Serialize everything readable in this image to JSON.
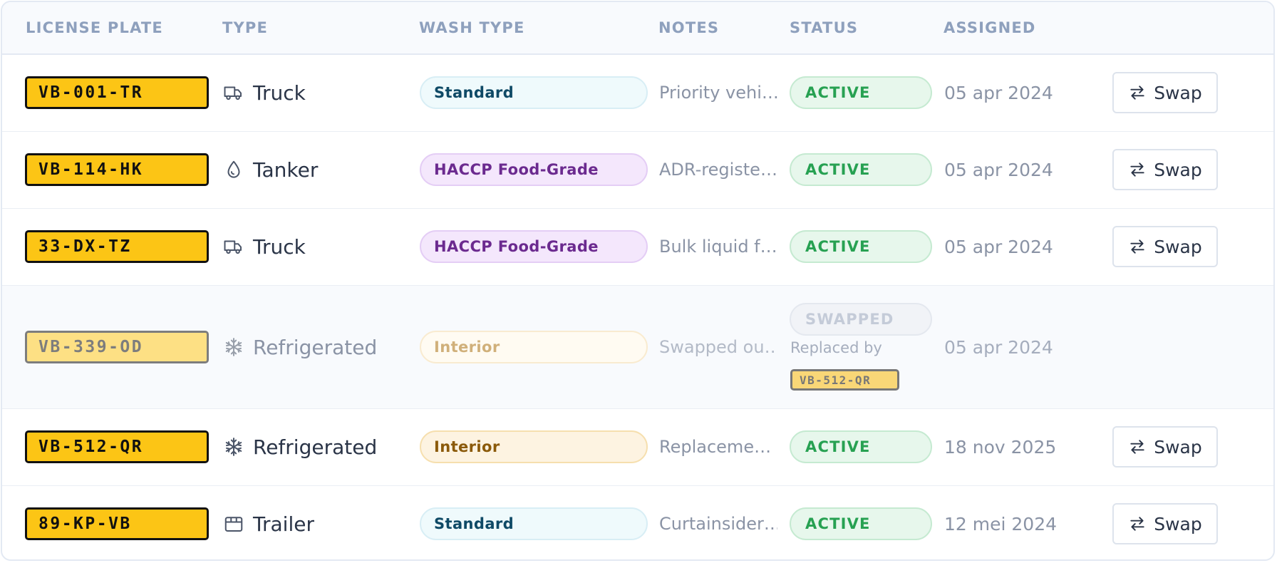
{
  "headers": {
    "license_plate": "LICENSE PLATE",
    "type": "TYPE",
    "wash_type": "WASH TYPE",
    "notes": "NOTES",
    "status": "STATUS",
    "assigned": "ASSIGNED"
  },
  "rows": [
    {
      "plate": "VB-001-TR",
      "type": "Truck",
      "type_icon": "truck-icon",
      "wash": "Standard",
      "notes": "Priority vehi…",
      "status": "ACTIVE",
      "assigned": "05 apr 2024",
      "action": "Swap"
    },
    {
      "plate": "VB-114-HK",
      "type": "Tanker",
      "type_icon": "droplet-icon",
      "wash": "HACCP Food-Grade",
      "notes": "ADR-registe…",
      "status": "ACTIVE",
      "assigned": "05 apr 2024",
      "action": "Swap"
    },
    {
      "plate": "33-DX-TZ",
      "type": "Truck",
      "type_icon": "truck-icon",
      "wash": "HACCP Food-Grade",
      "notes": "Bulk liquid f…",
      "status": "ACTIVE",
      "assigned": "05 apr 2024",
      "action": "Swap"
    },
    {
      "plate": "VB-339-OD",
      "type": "Refrigerated",
      "type_icon": "snowflake-icon",
      "wash": "Interior",
      "notes": "Swapped ou…",
      "status": "SWAPPED",
      "replaced_label": "Replaced by",
      "replaced_plate": "VB-512-QR",
      "assigned": "05 apr 2024"
    },
    {
      "plate": "VB-512-QR",
      "type": "Refrigerated",
      "type_icon": "snowflake-icon",
      "wash": "Interior",
      "notes": "Replaceme…",
      "status": "ACTIVE",
      "assigned": "18 nov 2025",
      "action": "Swap"
    },
    {
      "plate": "89-KP-VB",
      "type": "Trailer",
      "type_icon": "trailer-icon",
      "wash": "Standard",
      "notes": "Curtainsider…",
      "status": "ACTIVE",
      "assigned": "12 mei 2024",
      "action": "Swap"
    }
  ],
  "colors": {
    "plate_bg": "#fcc515",
    "active_green": "#27a152",
    "header_text": "#8ea0bd",
    "standard_text": "#0f4a66",
    "haccp_text": "#6b2a8f",
    "interior_text": "#8b5a0a"
  }
}
